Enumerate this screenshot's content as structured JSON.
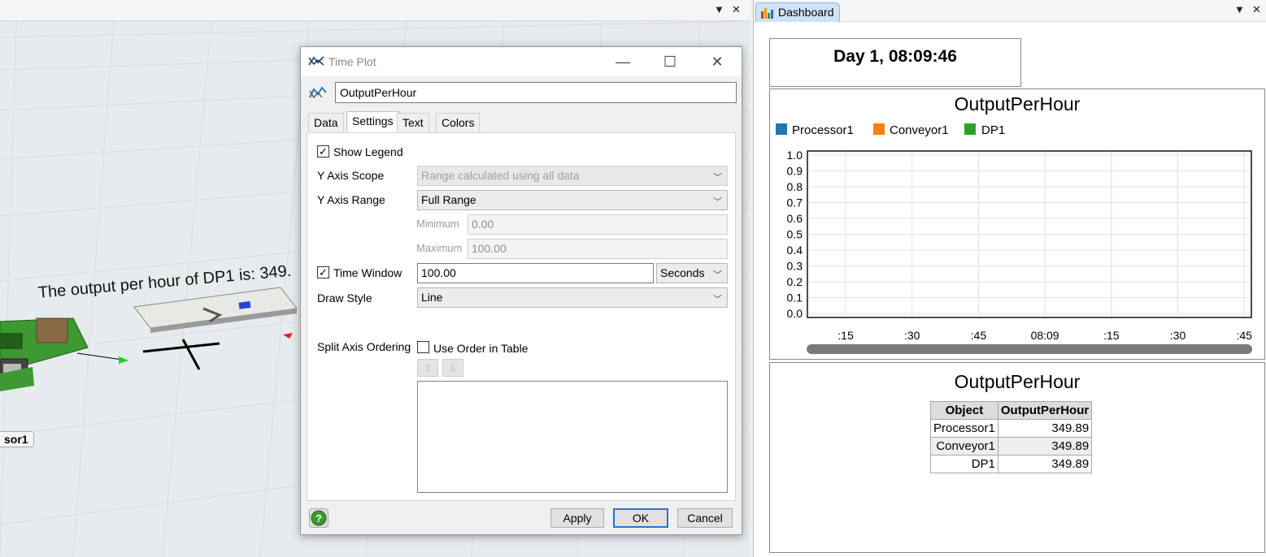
{
  "view3d": {
    "annotation": "The output per hour of DP1 is: 349.",
    "object_label": "sor1"
  },
  "window_controls": {
    "dropdown": "▼",
    "close": "✕"
  },
  "dialog": {
    "title": "Time Plot",
    "name_value": "OutputPerHour",
    "tabs": [
      "Data",
      "Settings",
      "Text",
      "Colors"
    ],
    "active_tab": "Settings",
    "settings": {
      "show_legend_label": "Show Legend",
      "show_legend_checked": true,
      "y_axis_scope_label": "Y Axis Scope",
      "y_axis_scope_value": "Range calculated using all data",
      "y_axis_range_label": "Y Axis Range",
      "y_axis_range_value": "Full Range",
      "minimum_label": "Minimum",
      "minimum_value": "0.00",
      "maximum_label": "Maximum",
      "maximum_value": "100.00",
      "time_window_label": "Time Window",
      "time_window_checked": true,
      "time_window_value": "100.00",
      "time_unit_value": "Seconds",
      "draw_style_label": "Draw Style",
      "draw_style_value": "Line",
      "split_axis_label": "Split Axis Ordering",
      "use_order_label": "Use Order in Table",
      "use_order_checked": false
    },
    "buttons": {
      "apply": "Apply",
      "ok": "OK",
      "cancel": "Cancel"
    }
  },
  "dashboard": {
    "tab_label": "Dashboard",
    "clock": "Day 1, 08:09:46",
    "colors": {
      "processor": "#1f77b4",
      "conveyor": "#ff7f0e",
      "dp": "#2ca02c"
    }
  },
  "chart_data": [
    {
      "type": "line",
      "title": "OutputPerHour",
      "series": [
        {
          "name": "Processor1",
          "values": []
        },
        {
          "name": "Conveyor1",
          "values": []
        },
        {
          "name": "DP1",
          "values": []
        }
      ],
      "y_ticks": [
        "1.0",
        "0.9",
        "0.8",
        "0.7",
        "0.6",
        "0.5",
        "0.4",
        "0.3",
        "0.2",
        "0.1",
        "0.0"
      ],
      "x_ticks": [
        ":15",
        ":30",
        ":45",
        "08:09",
        ":15",
        ":30",
        ":45"
      ],
      "ylim": [
        0,
        1
      ],
      "grid": true,
      "legend": "top-left"
    },
    {
      "type": "table",
      "title": "OutputPerHour",
      "columns": [
        "Object",
        "OutputPerHour"
      ],
      "rows": [
        [
          "Processor1",
          "349.89"
        ],
        [
          "Conveyor1",
          "349.89"
        ],
        [
          "DP1",
          "349.89"
        ]
      ]
    }
  ]
}
